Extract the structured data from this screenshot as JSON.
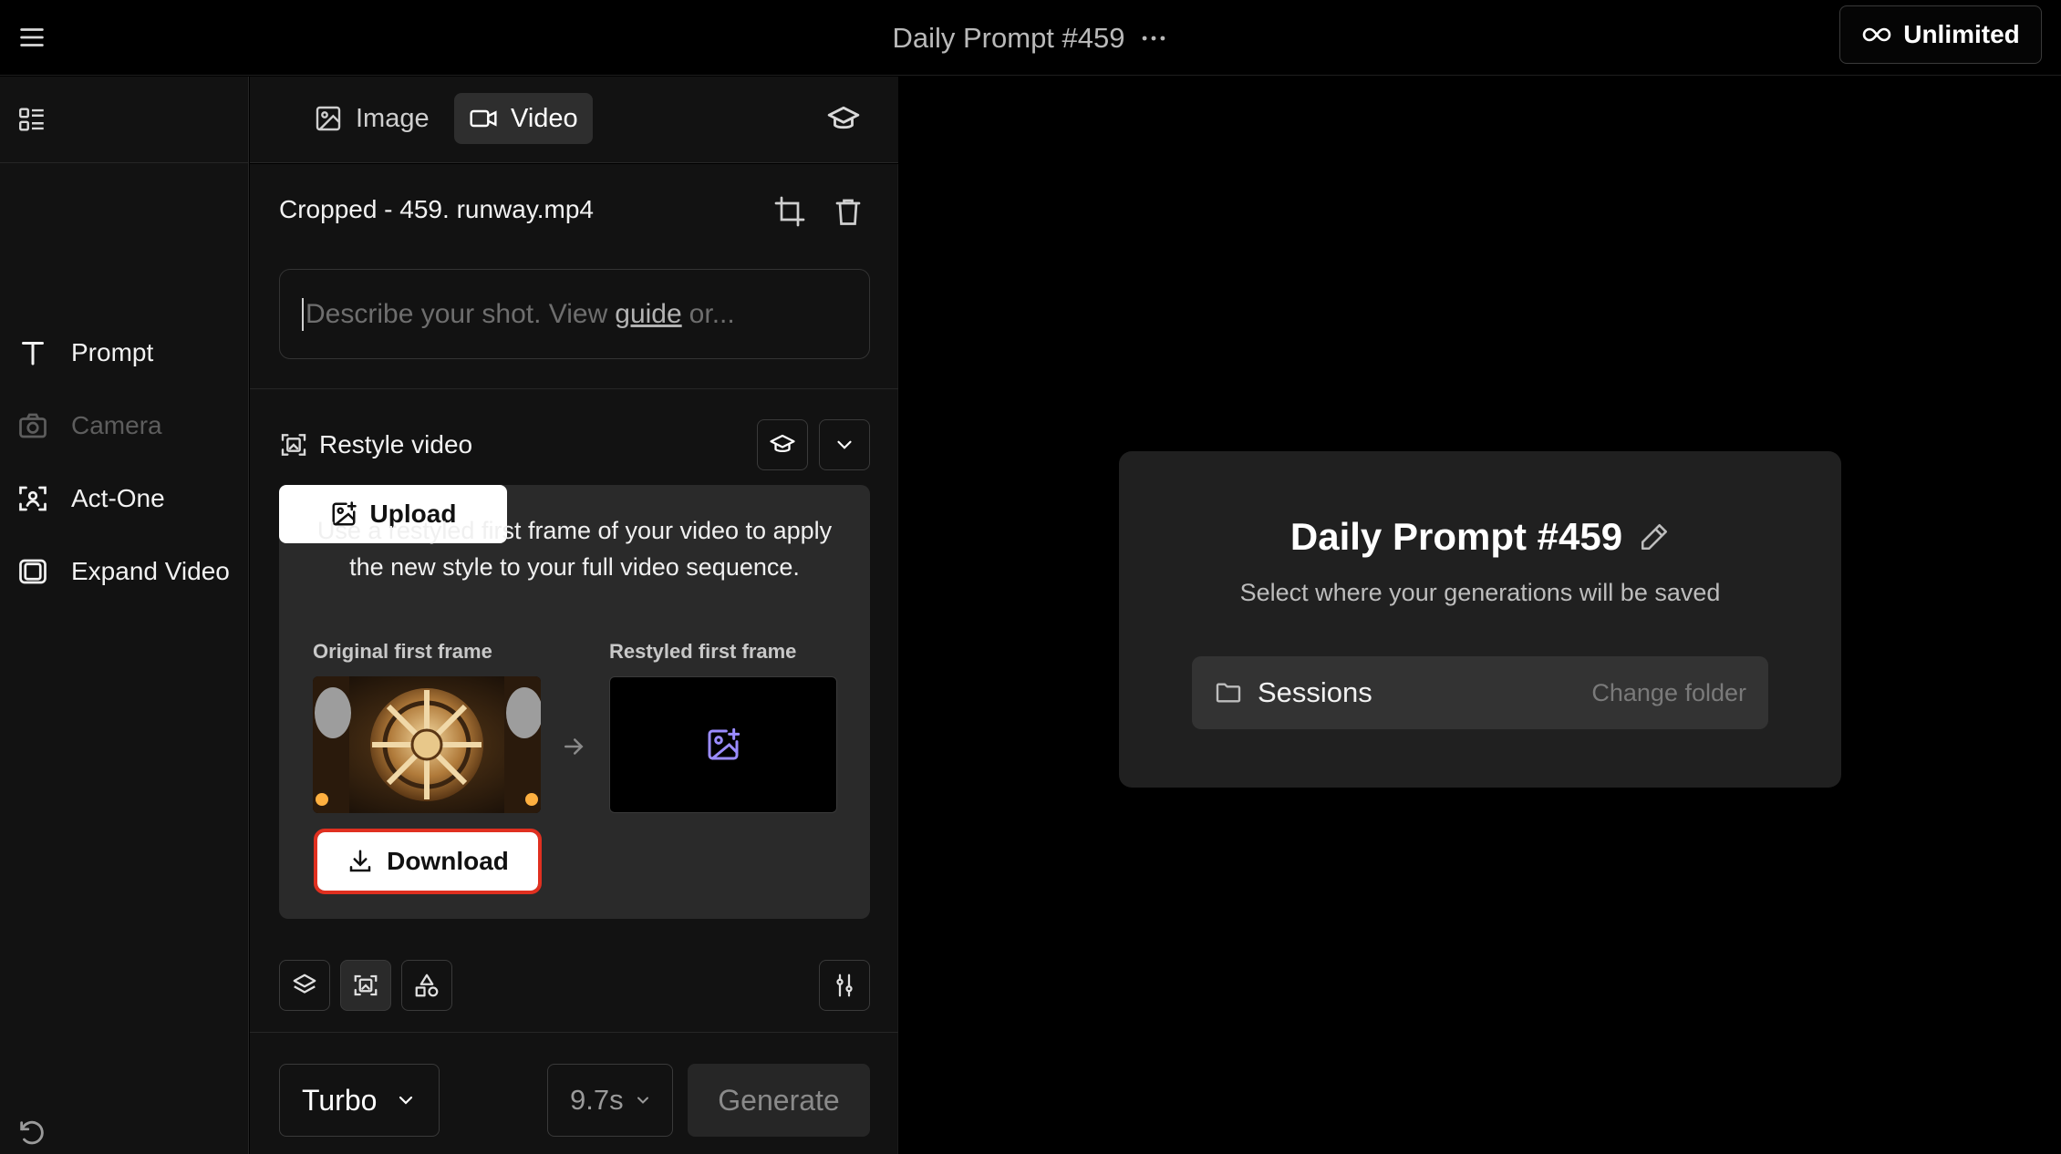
{
  "header": {
    "title": "Daily Prompt #459",
    "plan_label": "Unlimited"
  },
  "tabs": [
    {
      "label": "Image",
      "active": false
    },
    {
      "label": "Video",
      "active": true
    }
  ],
  "sidebar": {
    "items": [
      {
        "label": "Prompt",
        "icon": "text-icon",
        "enabled": true
      },
      {
        "label": "Camera",
        "icon": "camera-icon",
        "enabled": false
      },
      {
        "label": "Act-One",
        "icon": "face-scan-icon",
        "enabled": true
      },
      {
        "label": "Expand Video",
        "icon": "expand-frame-icon",
        "enabled": true
      }
    ]
  },
  "editor": {
    "file_name": "Cropped - 459. runway.mp4",
    "prompt_placeholder_before": "Describe your shot. View",
    "prompt_placeholder_link": "guide",
    "prompt_placeholder_after": "or...",
    "restyle": {
      "title": "Restyle video",
      "description": "Use a restyled first frame of your video to apply the new style to your full video sequence.",
      "original_label": "Original first frame",
      "restyled_label": "Restyled first frame",
      "download_label": "Download",
      "upload_label": "Upload"
    },
    "model": "Turbo",
    "duration": "9.7s",
    "generate_label": "Generate"
  },
  "session": {
    "title": "Daily Prompt #459",
    "subtitle": "Select where your generations will be saved",
    "folder": "Sessions",
    "change_folder_label": "Change folder"
  },
  "colors": {
    "background": "#000000",
    "panel": "#121212",
    "card": "#2a2a2a",
    "highlight": "#e03020",
    "accent_icon": "#9b8cff"
  }
}
